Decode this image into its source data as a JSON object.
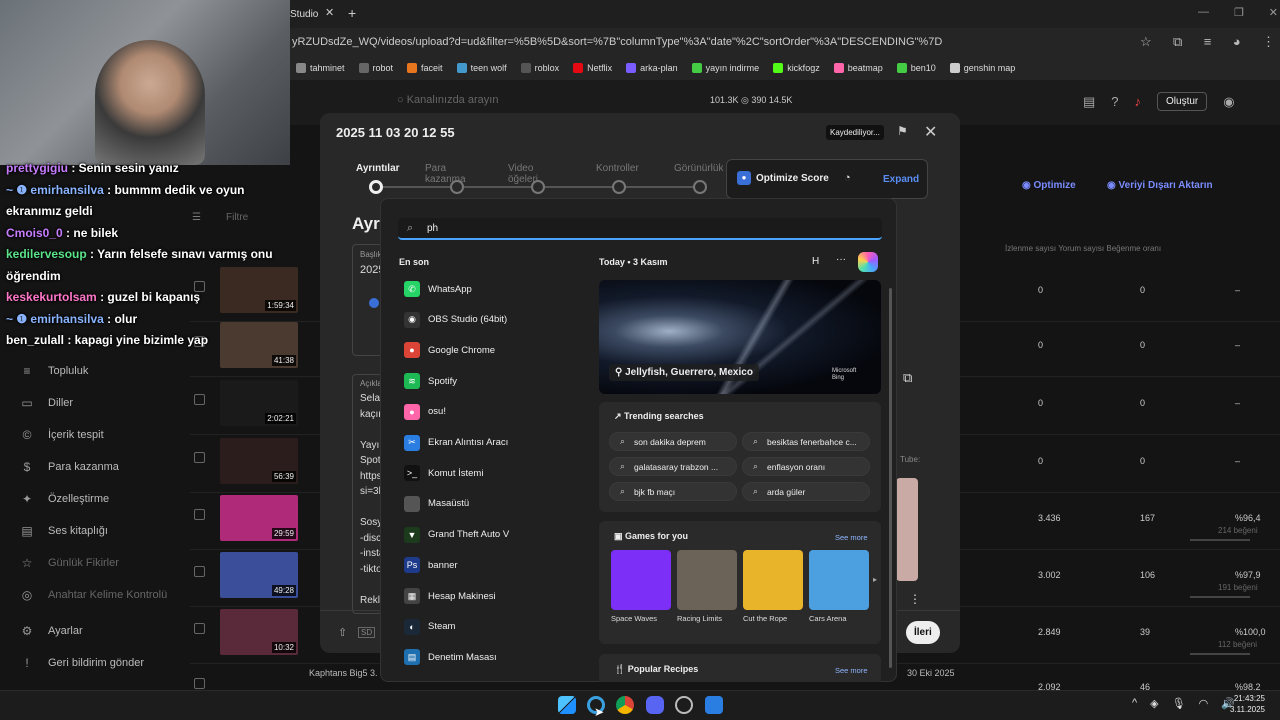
{
  "browser": {
    "tab_title": "Studio",
    "url": "yRZUDsdZe_WQ/videos/upload?d=ud&filter=%5B%5D&sort=%7B\"columnType\"%3A\"date\"%2C\"sortOrder\"%3A\"DESCENDING\"%7D",
    "bookmarks": [
      {
        "label": "tahminet",
        "color": "#888"
      },
      {
        "label": "robot",
        "color": "#666"
      },
      {
        "label": "faceit",
        "color": "#e8761e"
      },
      {
        "label": "teen wolf",
        "color": "#49c"
      },
      {
        "label": "roblox",
        "color": "#555"
      },
      {
        "label": "Netflix",
        "color": "#e50914"
      },
      {
        "label": "arka-plan",
        "color": "#7a5cff"
      },
      {
        "label": "yayın indirme",
        "color": "#4c4"
      },
      {
        "label": "kickfogz",
        "color": "#53fc18"
      },
      {
        "label": "beatmap",
        "color": "#ff66aa"
      },
      {
        "label": "ben10",
        "color": "#4c4"
      },
      {
        "label": "genshin map",
        "color": "#ccc"
      }
    ]
  },
  "yt": {
    "search_placeholder": "Kanalınızda arayın",
    "stats": "101.3K  ◎ 390  14.5K",
    "create_label": "Oluştur",
    "sidebar": [
      {
        "label": "Topluluk",
        "icon": "≡",
        "dim": false
      },
      {
        "label": "Diller",
        "icon": "▭",
        "dim": false
      },
      {
        "label": "İçerik tespit",
        "icon": "©",
        "dim": false
      },
      {
        "label": "Para kazanma",
        "icon": "$",
        "dim": false
      },
      {
        "label": "Özelleştirme",
        "icon": "✦",
        "dim": false
      },
      {
        "label": "Ses kitaplığı",
        "icon": "▤",
        "dim": false
      },
      {
        "label": "Günlük Fikirler",
        "icon": "☆",
        "dim": true
      },
      {
        "label": "Anahtar Kelime Kontrolü",
        "icon": "◎",
        "dim": true
      },
      {
        "label": "Ayarlar",
        "icon": "⚙",
        "dim": false
      },
      {
        "label": "Geri bildirim gönder",
        "icon": "!",
        "dim": false
      }
    ],
    "column_headers": "İzlenme sayısı        Yorum sayısı        Beğenme oranı",
    "rows": [
      {
        "duration": "1:59:34",
        "views": "0",
        "comments": "0",
        "likes": "–",
        "sub": "",
        "color": "#3a2a22"
      },
      {
        "duration": "41:38",
        "views": "0",
        "comments": "0",
        "likes": "–",
        "sub": "",
        "color": "#4a3a30"
      },
      {
        "duration": "2:02:21",
        "views": "0",
        "comments": "0",
        "likes": "–",
        "sub": "",
        "color": "#1a1a1a"
      },
      {
        "duration": "56:39",
        "views": "0",
        "comments": "0",
        "likes": "–",
        "sub": "",
        "color": "#2c1d1d"
      },
      {
        "duration": "29:59",
        "views": "3.436",
        "comments": "167",
        "likes": "%96,4",
        "sub": "214 beğeni",
        "color": "#b02a7a"
      },
      {
        "duration": "49:28",
        "views": "3.002",
        "comments": "106",
        "likes": "%97,9",
        "sub": "191 beğeni",
        "color": "#3a4e9a"
      },
      {
        "duration": "10:32",
        "views": "2.849",
        "comments": "39",
        "likes": "%100,0",
        "sub": "112 beğeni",
        "color": "#5a2a3a"
      },
      {
        "duration": "",
        "views": "2.092",
        "comments": "46",
        "likes": "%98,2",
        "sub": "",
        "color": "#2a2a2a"
      }
    ],
    "row_title_last": "Kaphtans Big5 3. B",
    "row_date_last": "30 Eki 2025",
    "optimize_label": "Optimize",
    "export_label": "Veriyi Dışarı Aktarın",
    "filter_label": "Filtre"
  },
  "chat": [
    {
      "user": "prettygigiu",
      "msg": " : Senin sesin yanız",
      "color": "#c77dff"
    },
    {
      "user": "~ ❶ emirhansilva",
      "msg": " : bummm dedik ve oyun ekranımız geldi",
      "color": "#8ab4ff"
    },
    {
      "user": "Cmois0_0",
      "msg": " : ne bilek",
      "color": "#c77dff"
    },
    {
      "user": "kedilervesoup",
      "msg": " : Yarın felsefe sınavı varmış onu öğrendim",
      "color": "#5be38a"
    },
    {
      "user": "keskekurtolsam",
      "msg": " : guzel bi kapanış",
      "color": "#ff77c8"
    },
    {
      "user": "~ ❶ emirhansilva",
      "msg": " : olur",
      "color": "#8ab4ff"
    },
    {
      "user": "ben_zulall",
      "msg": " : kapagi yine bizimle yap",
      "color": "#ffffff"
    }
  ],
  "modal": {
    "title": "2025 11 03 20 12 55",
    "save_status": "Kaydediliyor...",
    "steps": [
      "Ayrıntılar",
      "Para kazanma",
      "Video öğeleri",
      "Kontroller",
      "Görünürlük"
    ],
    "optimize_score": "Optimize Score",
    "expand": "Expand",
    "heading": "Ayrı",
    "title_field_label": "Başlık",
    "title_field_value": "2025",
    "desc_label": "Açıkla",
    "desc_lines": [
      "Selar",
      "kaçır",
      "",
      "Yayı",
      "Spoti",
      "https",
      "si=3b",
      "",
      "Sosy",
      "-disc",
      "-insta",
      "-tikto",
      "",
      "Rekl"
    ],
    "next_button": "İleri"
  },
  "start": {
    "query": "ph",
    "recent_label": "En son",
    "apps": [
      {
        "label": "WhatsApp",
        "color": "#25d366",
        "glyph": "✆"
      },
      {
        "label": "OBS Studio (64bit)",
        "color": "#333",
        "glyph": "◉"
      },
      {
        "label": "Google Chrome",
        "color": "#db4437",
        "glyph": "●"
      },
      {
        "label": "Spotify",
        "color": "#1db954",
        "glyph": "≋"
      },
      {
        "label": "osu!",
        "color": "#ff66aa",
        "glyph": "●"
      },
      {
        "label": "Ekran Alıntısı Aracı",
        "color": "#2a7de1",
        "glyph": "✂"
      },
      {
        "label": "Komut İstemi",
        "color": "#111",
        "glyph": ">_"
      },
      {
        "label": "Masaüstü",
        "color": "#555",
        "glyph": ""
      },
      {
        "label": "Grand Theft Auto V",
        "color": "#1c3a1c",
        "glyph": "▼"
      },
      {
        "label": "banner",
        "color": "#1e3a8a",
        "glyph": "Ps"
      },
      {
        "label": "Hesap Makinesi",
        "color": "#444",
        "glyph": "▦"
      },
      {
        "label": "Steam",
        "color": "#1b2838",
        "glyph": "◐"
      },
      {
        "label": "Denetim Masası",
        "color": "#1e6fb0",
        "glyph": "▤"
      }
    ],
    "today_label": "Today • 3 Kasım",
    "h_badge": "H",
    "hero_caption": "Jellyfish, Guerrero, Mexico",
    "bing_label": "Microsoft\nBing",
    "trending_label": "Trending searches",
    "trending": [
      "son dakika deprem",
      "besiktas fenerbahce c...",
      "galatasaray trabzon ...",
      "enflasyon oranı",
      "bjk fb maçı",
      "arda güler"
    ],
    "games_label": "Games for you",
    "see_more": "See more",
    "games": [
      {
        "name": "Space Waves",
        "color": "#7b2ff7"
      },
      {
        "name": "Racing Limits",
        "color": "#6b6258"
      },
      {
        "name": "Cut the Rope",
        "color": "#e8b42a"
      },
      {
        "name": "Cars Arena",
        "color": "#4da0e0"
      }
    ],
    "recipes_label": "Popular Recipes"
  },
  "taskbar": {
    "time": "21:43:25",
    "date": "3.11.2025"
  }
}
